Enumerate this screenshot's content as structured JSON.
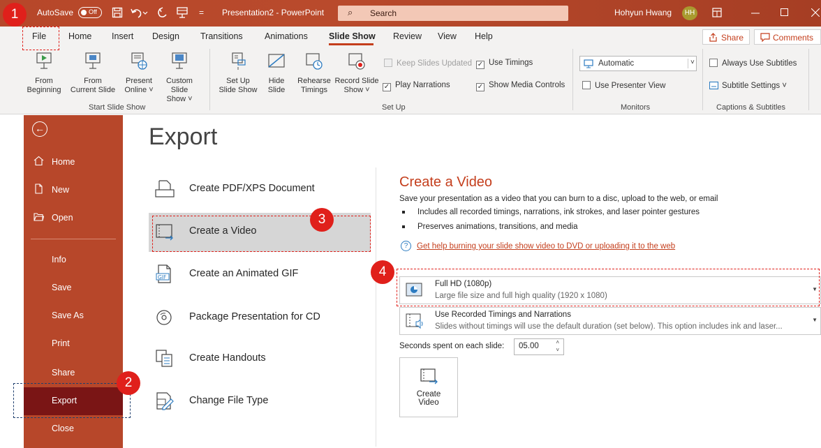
{
  "titlebar": {
    "autosave_label": "AutoSave",
    "autosave_state": "Off",
    "doc_title": "Presentation2 - PowerPoint",
    "search_placeholder": "Search",
    "user_name": "Hohyun Hwang",
    "user_initials": "HH",
    "bg_color": "#b7472a"
  },
  "tabs": [
    {
      "label": "File"
    },
    {
      "label": "Home"
    },
    {
      "label": "Insert"
    },
    {
      "label": "Design"
    },
    {
      "label": "Transitions"
    },
    {
      "label": "Animations"
    },
    {
      "label": "Slide Show"
    },
    {
      "label": "Review"
    },
    {
      "label": "View"
    },
    {
      "label": "Help"
    }
  ],
  "share_label": "Share",
  "comments_label": "Comments",
  "ribbon": {
    "start": {
      "from_beginning": [
        "From",
        "Beginning"
      ],
      "from_current": [
        "From",
        "Current Slide"
      ],
      "present_online": [
        "Present",
        "Online ˅"
      ],
      "custom_slide_show": [
        "Custom Slide",
        "Show ˅"
      ],
      "group_label": "Start Slide Show"
    },
    "setup": {
      "set_up_slide_show": [
        "Set Up",
        "Slide Show"
      ],
      "hide_slide": [
        "Hide",
        "Slide"
      ],
      "rehearse_timings": [
        "Rehearse",
        "Timings"
      ],
      "record_slide_show": [
        "Record Slide",
        "Show ˅"
      ],
      "keep_slides_updated": "Keep Slides Updated",
      "use_timings": "Use Timings",
      "play_narrations": "Play Narrations",
      "show_media_controls": "Show Media Controls",
      "group_label": "Set Up"
    },
    "monitors": {
      "monitor_value": "Automatic",
      "use_presenter_view": "Use Presenter View",
      "group_label": "Monitors"
    },
    "captions": {
      "always_use_subtitles": "Always Use Subtitles",
      "subtitle_settings": "Subtitle Settings ˅",
      "group_label": "Captions & Subtitles"
    }
  },
  "sidebar": {
    "items": [
      {
        "label": "Home"
      },
      {
        "label": "New"
      },
      {
        "label": "Open"
      },
      {
        "label": "Info"
      },
      {
        "label": "Save"
      },
      {
        "label": "Save As"
      },
      {
        "label": "Print"
      },
      {
        "label": "Share"
      },
      {
        "label": "Export"
      },
      {
        "label": "Close"
      }
    ]
  },
  "export": {
    "title": "Export",
    "items": [
      {
        "label": "Create PDF/XPS Document"
      },
      {
        "label": "Create a Video"
      },
      {
        "label": "Create an Animated GIF"
      },
      {
        "label": "Package Presentation for CD"
      },
      {
        "label": "Create Handouts"
      },
      {
        "label": "Change File Type"
      }
    ],
    "gif_icon_text": "GIF"
  },
  "video": {
    "heading": "Create a Video",
    "description": "Save your presentation as a video that you can burn to a disc, upload to the web, or email",
    "bullets": [
      "Includes all recorded timings, narrations, ink strokes, and laser pointer gestures",
      "Preserves animations, transitions, and media"
    ],
    "help_link": "Get help burning your slide show video to DVD or uploading it to the web",
    "quality": {
      "title": "Full HD (1080p)",
      "subtitle": "Large file size and full high quality (1920 x 1080)"
    },
    "timings": {
      "title": "Use Recorded Timings and Narrations",
      "subtitle": "Slides without timings will use the default duration (set below). This option includes ink and laser..."
    },
    "seconds_label": "Seconds spent on each slide:",
    "seconds_value": "05.00",
    "create_button": [
      "Create",
      "Video"
    ]
  },
  "callouts": [
    "1",
    "2",
    "3",
    "4"
  ]
}
